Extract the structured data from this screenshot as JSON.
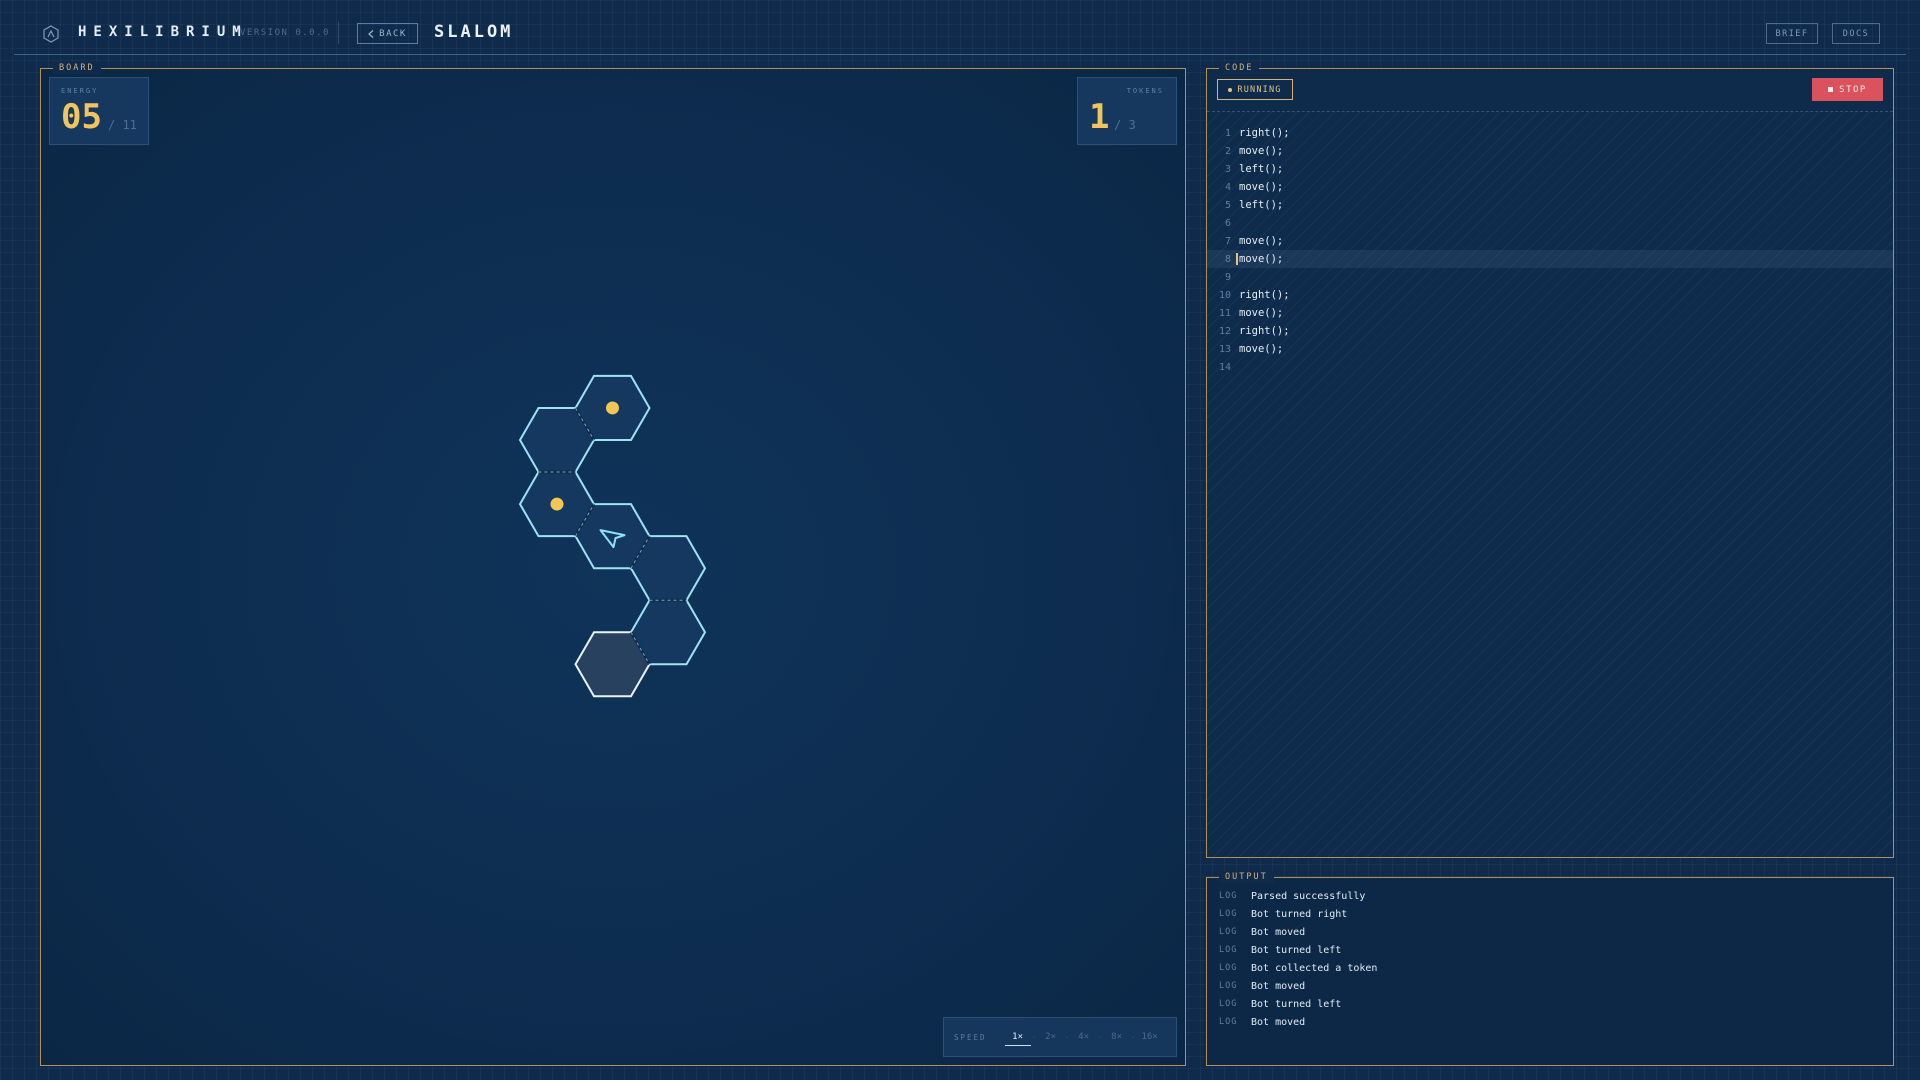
{
  "header": {
    "brand": "HEXILIBRIUM",
    "version": "VERSION 0.0.0",
    "back_label": "BACK",
    "level_title": "SLALOM",
    "brief_label": "BRIEF",
    "docs_label": "DOCS"
  },
  "board": {
    "label": "BOARD",
    "energy": {
      "label": "ENERGY",
      "value": "05",
      "total": "/ 11"
    },
    "tokens": {
      "label": "TOKENS",
      "value": "1",
      "total": "/ 3"
    },
    "speed": {
      "label": "SPEED",
      "options": [
        "1×",
        "2×",
        "4×",
        "8×",
        "16×"
      ],
      "selected": "1×"
    },
    "grid": {
      "cells": [
        {
          "q": 1,
          "r": -1,
          "token": true
        },
        {
          "q": 0,
          "r": 0
        },
        {
          "q": 0,
          "r": 1,
          "token": true
        },
        {
          "q": 1,
          "r": 1,
          "bot": true
        },
        {
          "q": 2,
          "r": 1
        },
        {
          "q": 2,
          "r": 2
        },
        {
          "q": 1,
          "r": 3,
          "goal": true
        }
      ],
      "bot_heading": "up-left"
    },
    "colors": {
      "cell_stroke": "#9fe2f5",
      "token": "#f4c653",
      "bot": "#8fe0f5",
      "goal_fill": "#27415f"
    }
  },
  "code": {
    "label": "CODE",
    "status": "RUNNING",
    "stop_label": "STOP",
    "current_line": 8,
    "lines": [
      "right();",
      "move();",
      "left();",
      "move();",
      "left();",
      "",
      "move();",
      "move();",
      "",
      "right();",
      "move();",
      "right();",
      "move();",
      ""
    ]
  },
  "output": {
    "label": "OUTPUT",
    "entries": [
      {
        "level": "LOG",
        "message": "Parsed successfully"
      },
      {
        "level": "LOG",
        "message": "Bot turned right"
      },
      {
        "level": "LOG",
        "message": "Bot moved"
      },
      {
        "level": "LOG",
        "message": "Bot turned left"
      },
      {
        "level": "LOG",
        "message": "Bot collected a token"
      },
      {
        "level": "LOG",
        "message": "Bot moved"
      },
      {
        "level": "LOG",
        "message": "Bot turned left"
      },
      {
        "level": "LOG",
        "message": "Bot moved"
      }
    ]
  },
  "icons": [
    "logo-icon",
    "chevron-left-icon",
    "bot-arrow-icon",
    "stop-icon",
    "status-dot-icon"
  ]
}
